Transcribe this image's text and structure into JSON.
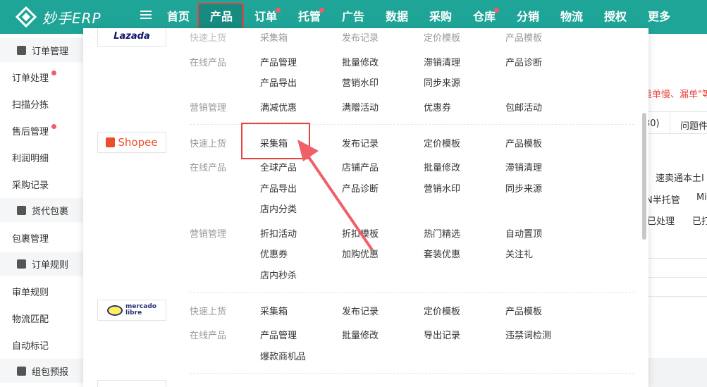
{
  "brand": {
    "name": "妙手ERP"
  },
  "nav": [
    {
      "label": "首页",
      "dot": false
    },
    {
      "label": "产品",
      "dot": false,
      "active": true
    },
    {
      "label": "订单",
      "dot": true
    },
    {
      "label": "托管",
      "dot": true
    },
    {
      "label": "广告",
      "dot": false
    },
    {
      "label": "数据",
      "dot": false
    },
    {
      "label": "采购",
      "dot": false
    },
    {
      "label": "仓库",
      "dot": true
    },
    {
      "label": "分销",
      "dot": false
    },
    {
      "label": "物流",
      "dot": false
    },
    {
      "label": "授权",
      "dot": false
    },
    {
      "label": "更多",
      "dot": false
    }
  ],
  "sidebar": {
    "sections": [
      {
        "label": "订单管理",
        "icon": "document-icon"
      },
      {
        "label": "货代包裹",
        "icon": "wallet-icon"
      },
      {
        "label": "订单规则",
        "icon": "document-icon"
      },
      {
        "label": "组包预报",
        "icon": "document-icon"
      }
    ],
    "items": [
      "订单处理",
      "扫描分拣",
      "售后管理",
      "利润明细",
      "采购记录",
      "包裹管理",
      "审单规则",
      "物流匹配",
      "自动标记"
    ]
  },
  "background": {
    "notice": "量单慢、漏单\"等",
    "tab_count": "30)",
    "tab_issue": "问题件",
    "t1": "速卖通本土I",
    "t2": "N半托管",
    "t3": "Mi",
    "t4": "已处理",
    "t5": "已打"
  },
  "dropdown": {
    "lazada": {
      "logo": "Lazada",
      "cut_label": "快速上货",
      "cut_links": [
        "采集箱",
        "发布记录",
        "定价模板",
        "产品模板"
      ],
      "online_label": "在线产品",
      "online_links": [
        "产品管理",
        "批量修改",
        "滞销清理",
        "产品诊断",
        "产品导出",
        "营销水印",
        "同步来源"
      ],
      "marketing_label": "营销管理",
      "marketing_links": [
        "满减优惠",
        "满赠活动",
        "优惠券",
        "包邮活动"
      ]
    },
    "shopee": {
      "logo": "Shopee",
      "quick_label": "快速上货",
      "quick_links": [
        "采集箱",
        "发布记录",
        "定价模板",
        "产品模板"
      ],
      "online_label": "在线产品",
      "online_links": [
        "全球产品",
        "店铺产品",
        "批量修改",
        "滞销清理",
        "产品导出",
        "产品诊断",
        "营销水印",
        "同步来源",
        "店内分类"
      ],
      "marketing_label": "营销管理",
      "marketing_links": [
        "折扣活动",
        "折扣模板",
        "热门精选",
        "自动置顶",
        "优惠券",
        "加购优惠",
        "套装优惠",
        "关注礼",
        "店内秒杀"
      ]
    },
    "mercado": {
      "logo_line1": "mercado",
      "logo_line2": "libre",
      "quick_label": "快速上货",
      "quick_links": [
        "采集箱",
        "发布记录",
        "定价模板",
        "产品模板"
      ],
      "online_label": "在线产品",
      "online_links": [
        "产品管理",
        "批量修改",
        "导出记录",
        "违禁词检测",
        "爆款商机品"
      ]
    }
  },
  "colors": {
    "primary": "#1fa598",
    "accent": "#e9433f",
    "shopee": "#ee4d2d",
    "lazada": "#0f146d"
  }
}
